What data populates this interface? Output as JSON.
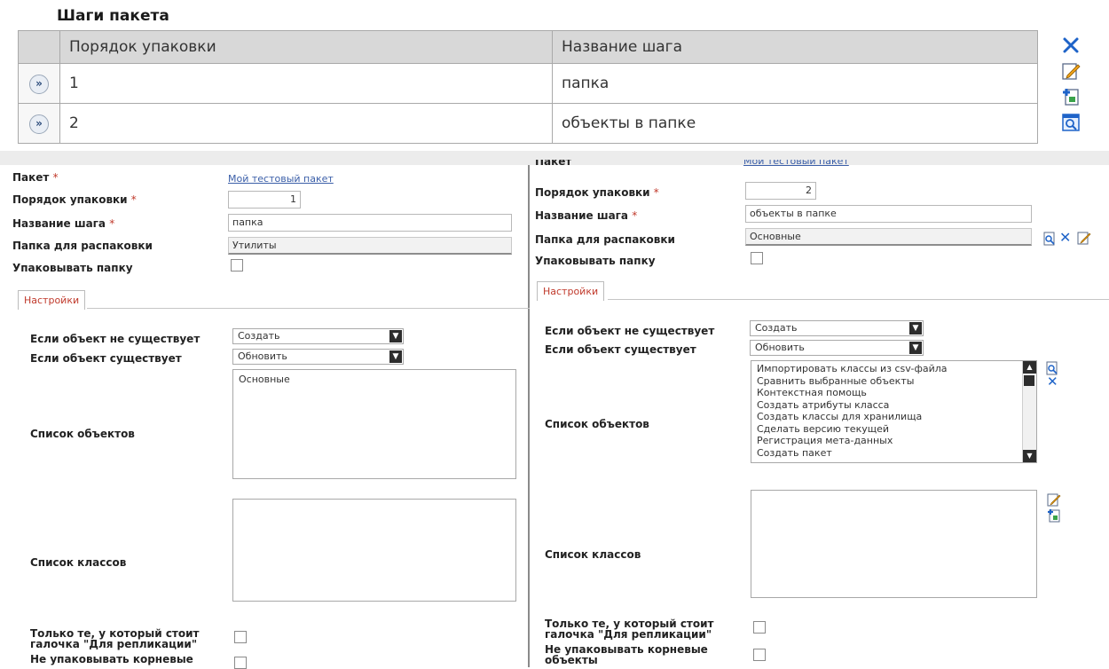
{
  "steps": {
    "title": "Шаги пакета",
    "columns": [
      "Порядок упаковки",
      "Название шага"
    ],
    "rows": [
      {
        "order": "1",
        "name": "папка"
      },
      {
        "order": "2",
        "name": "объекты в папке"
      }
    ]
  },
  "left_form": {
    "package_label": "Пакет",
    "package_value": "Мой тестовый пакет",
    "order_label": "Порядок упаковки",
    "order_value": "1",
    "step_name_label": "Название шага",
    "step_name_value": "папка",
    "unpack_folder_label": "Папка для распаковки",
    "unpack_folder_value": "Утилиты",
    "pack_folder_label": "Упаковывать папку",
    "tab_label": "Настройки",
    "if_not_exists_label": "Если объект не существует",
    "if_not_exists_value": "Создать",
    "if_exists_label": "Если объект существует",
    "if_exists_value": "Обновить",
    "objects_label": "Список объектов",
    "objects_items": [
      "Основные"
    ],
    "classes_label": "Список классов",
    "replication_label_1": "Только те, у который стоит",
    "replication_label_2": "галочка \"Для репликации\"",
    "no_root_label_1": "Не упаковывать корневые"
  },
  "right_form": {
    "package_label": "Пакет",
    "package_value": "Мой тестовый пакет",
    "order_label": "Порядок упаковки",
    "order_value": "2",
    "step_name_label": "Название шага",
    "step_name_value": "объекты в папке",
    "unpack_folder_label": "Папка для распаковки",
    "unpack_folder_value": "Основные",
    "pack_folder_label": "Упаковывать папку",
    "tab_label": "Настройки",
    "if_not_exists_label": "Если объект не существует",
    "if_not_exists_value": "Создать",
    "if_exists_label": "Если объект существует",
    "if_exists_value": "Обновить",
    "objects_label": "Список объектов",
    "objects_items": [
      "Импортировать классы из csv-файла",
      "Сравнить выбранные объекты",
      "Контекстная помощь",
      "Создать атрибуты класса",
      "Создать классы для хранилища",
      "Сделать версию текущей",
      "Регистрация мета-данных",
      "Создать пакет"
    ],
    "classes_label": "Список классов",
    "replication_label_1": "Только те, у который стоит",
    "replication_label_2": "галочка \"Для репликации\"",
    "no_root_label_1": "Не упаковывать корневые",
    "no_root_label_2": "объекты"
  },
  "icons": {
    "toolbar": [
      "delete-icon",
      "edit-icon",
      "add-icon",
      "view-icon"
    ],
    "expand_glyph": "»",
    "delete_glyph": "✕",
    "select_arrow": "▼",
    "colors": {
      "blue": "#1e63c8",
      "required": "#c0392b",
      "link": "#3a5ea8"
    }
  }
}
